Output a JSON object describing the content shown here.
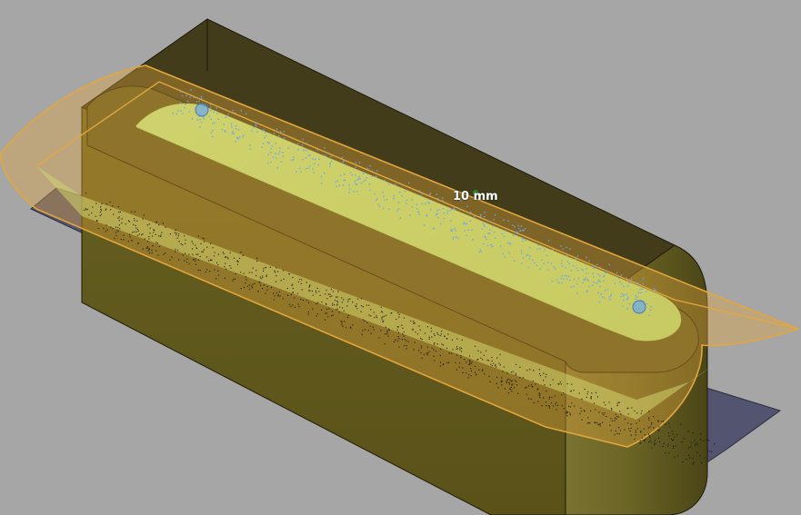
{
  "viewport": {
    "background_color": "#a6a6a6"
  },
  "scene": {
    "box_face_dark": "#423c1b",
    "box_face_mid": "#5e561e",
    "box_face_light": "#6b6425",
    "edge_color": "#1c1a08",
    "plane_color": "#e3a63c",
    "mesh_color": "#c8f08e",
    "point_cloud_color": "#6aa6e8",
    "base_plate_color": "#535570"
  },
  "annotation": {
    "dimension_text": "10 mm",
    "anchor_marker_color": "#2e8b2e"
  }
}
